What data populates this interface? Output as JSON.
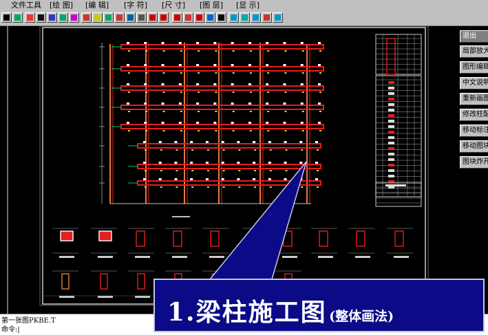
{
  "menu": [
    {
      "id": "file",
      "label": "文件工具"
    },
    {
      "id": "draw",
      "label": "[绘 图]"
    },
    {
      "id": "edit",
      "label": "[编 辑]"
    },
    {
      "id": "text",
      "label": "[字 符]"
    },
    {
      "id": "dim",
      "label": "[尺 寸]"
    },
    {
      "id": "layer",
      "label": "[图 层]"
    },
    {
      "id": "display",
      "label": "[显 示]"
    }
  ],
  "toolbar_icons": [
    "print-icon",
    "save-icon",
    "color-icon",
    "line-icon",
    "pan-icon",
    "grid-icon",
    "chinese-text-icon",
    "layer-icon",
    "info-icon",
    "measure-icon",
    "snap-icon",
    "edit-icon",
    "pen-icon",
    "undo-icon",
    "redo-icon",
    "window-icon",
    "move-icon",
    "copy-icon",
    "align-icon",
    "arc-icon",
    "zoom-all-icon",
    "zoom-color-icon",
    "zoom-in-icon",
    "zoom-window-icon",
    "zoom-out-icon"
  ],
  "side_menu": [
    "退出",
    "局部放大",
    "图形编辑",
    "中文说明",
    "重新画图",
    "修改柱配筋",
    "移动标注",
    "移动图块",
    "图块炸开"
  ],
  "status": {
    "file_line": "第一张图PKBE.T",
    "command_line": "命令:|"
  },
  "callout": {
    "main": "1.梁柱施工图",
    "sub": "(整体画法)"
  },
  "colors": {
    "beam": "#e51f1f",
    "frame": "#ffffff",
    "callout_bg": "#0b0b88",
    "canvas_bg": "#000000"
  }
}
